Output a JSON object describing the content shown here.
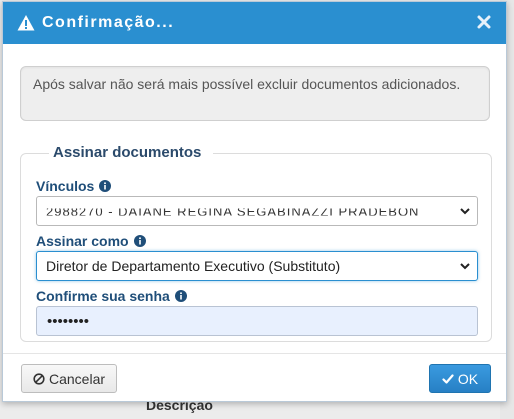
{
  "dialog": {
    "title": "Confirmação...",
    "title_icon": "warning-icon",
    "close_icon": "close-icon",
    "accent_color": "#2a8fd0"
  },
  "alert": {
    "message": "Após salvar não será mais possível excluir documentos adicionados."
  },
  "sign_section": {
    "legend": "Assinar documentos",
    "vinculos": {
      "label": "Vínculos",
      "icon": "info-icon",
      "selected_value": "2988270 - DAIANE REGINA SEGABINAZZI PRADEBON"
    },
    "assinar_como": {
      "label": "Assinar como",
      "icon": "info-icon",
      "selected_value": "Diretor de Departamento Executivo (Substituto)"
    },
    "senha": {
      "label": "Confirme sua senha",
      "icon": "info-icon",
      "value": "••••••••"
    }
  },
  "footer": {
    "cancel_label": "Cancelar",
    "cancel_icon": "ban-icon",
    "ok_label": "OK",
    "ok_icon": "check-icon"
  },
  "background": {
    "fragment_text": "Descrição"
  }
}
